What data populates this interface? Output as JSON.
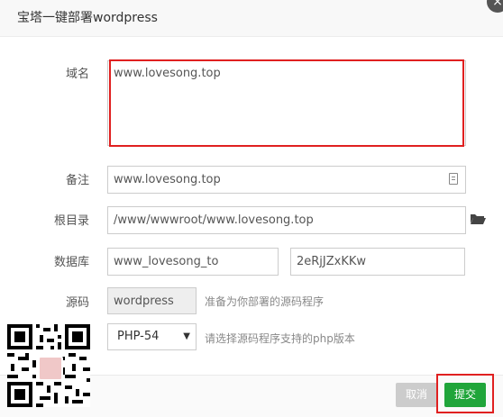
{
  "dialog": {
    "title": "宝塔一键部署wordpress",
    "close_glyph": "×"
  },
  "form": {
    "domain": {
      "label": "域名",
      "value": "www.lovesong.top"
    },
    "notes": {
      "label": "备注",
      "value": "www.lovesong.top",
      "icon": "notes-icon"
    },
    "root": {
      "label": "根目录",
      "value": "/www/wwwroot/www.lovesong.top",
      "icon": "folder-icon"
    },
    "database": {
      "label": "数据库",
      "name_value": "www_lovesong_to",
      "password_value": "2eRjJZxKKw"
    },
    "source": {
      "label": "源码",
      "value": "wordpress",
      "hint": "准备为你部署的源码程序"
    },
    "php": {
      "selected": "PHP-54",
      "hint": "请选择源码程序支持的php版本"
    }
  },
  "footer": {
    "cancel_label": "取消",
    "submit_label": "提交"
  },
  "colors": {
    "accent": "#20a53a",
    "highlight": "#e02020",
    "cancel_bg": "#cccccc"
  },
  "overlay": {
    "qr_code": "qr-code-image",
    "avatar": "avatar-image"
  }
}
